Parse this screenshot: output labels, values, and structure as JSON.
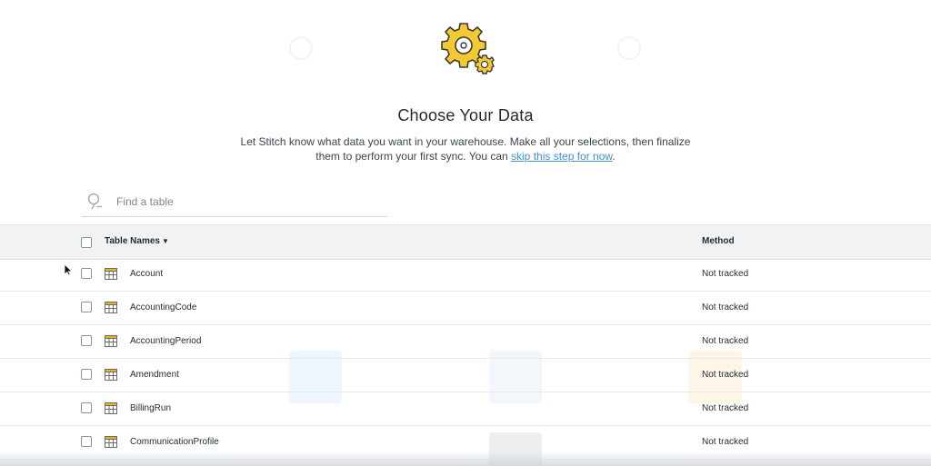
{
  "header": {
    "title": "Choose Your Data",
    "subtitle_text": "Let Stitch know what data you want in your warehouse. Make all your selections, then finalize them to perform your first sync. You can ",
    "skip_link": "skip this step for now",
    "subtitle_end": "."
  },
  "search": {
    "placeholder": "Find a table",
    "value": ""
  },
  "table": {
    "header_names": "Table Names",
    "header_method": "Method",
    "rows": [
      {
        "name": "Account",
        "method": "Not tracked"
      },
      {
        "name": "AccountingCode",
        "method": "Not tracked"
      },
      {
        "name": "AccountingPeriod",
        "method": "Not tracked"
      },
      {
        "name": "Amendment",
        "method": "Not tracked"
      },
      {
        "name": "BillingRun",
        "method": "Not tracked"
      },
      {
        "name": "CommunicationProfile",
        "method": "Not tracked"
      }
    ]
  },
  "colors": {
    "accent_link": "#3f8fd2",
    "gear_yellow": "#f2c930",
    "table_icon": "#e6b422",
    "header_bg": "#f1f2f3"
  },
  "icons": {
    "hero": "gears-icon",
    "search": "magnifier-icon",
    "table": "table-grid-icon",
    "cursor": "mouse-pointer-icon"
  }
}
